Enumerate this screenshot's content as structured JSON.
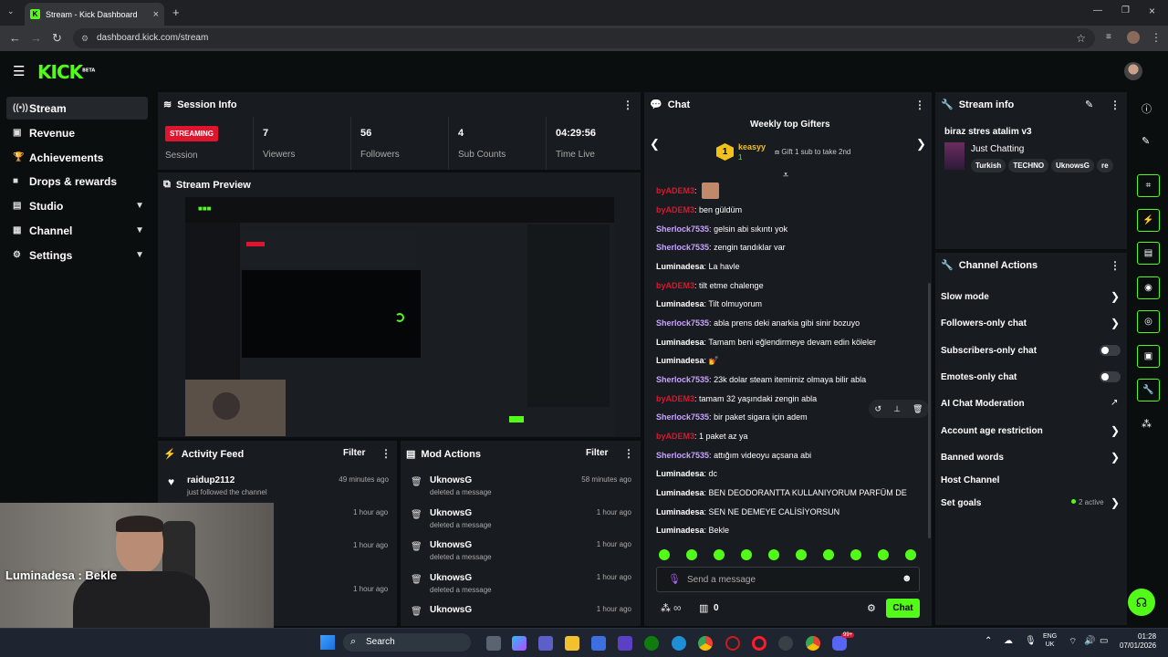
{
  "browser": {
    "tab_title": "Stream - Kick Dashboard",
    "url": "dashboard.kick.com/stream"
  },
  "header": {
    "logo": "KICK",
    "logo_tag": "BETA"
  },
  "sidebar": {
    "items": [
      {
        "label": "Stream",
        "icon": "broadcast-icon"
      },
      {
        "label": "Revenue",
        "icon": "revenue-icon"
      },
      {
        "label": "Achievements",
        "icon": "trophy-icon"
      },
      {
        "label": "Drops & rewards",
        "icon": "gift-icon"
      },
      {
        "label": "Studio",
        "icon": "studio-icon"
      },
      {
        "label": "Channel",
        "icon": "channel-icon"
      },
      {
        "label": "Settings",
        "icon": "gear-icon"
      }
    ]
  },
  "session": {
    "title": "Session Info",
    "status": "STREAMING",
    "status_label": "Session",
    "stats": [
      {
        "value": "7",
        "label": "Viewers"
      },
      {
        "value": "56",
        "label": "Followers"
      },
      {
        "value": "4",
        "label": "Sub Counts"
      },
      {
        "value": "04:29:56",
        "label": "Time Live"
      }
    ]
  },
  "preview": {
    "title": "Stream Preview"
  },
  "activity": {
    "title": "Activity Feed",
    "filter": "Filter",
    "items": [
      {
        "name": "raidup2112",
        "sub": "just followed the channel",
        "time": "49 minutes ago"
      },
      {
        "name": "",
        "sub": "",
        "time": "1 hour ago"
      },
      {
        "name": "",
        "sub": "",
        "time": "1 hour ago"
      },
      {
        "name": "",
        "sub": "",
        "time": "1 hour ago"
      }
    ]
  },
  "overlay": {
    "text": "Luminadesa : Bekle"
  },
  "mod": {
    "title": "Mod Actions",
    "filter": "Filter",
    "items": [
      {
        "name": "UknowsG",
        "sub": "deleted a message",
        "time": "58 minutes ago"
      },
      {
        "name": "UknowsG",
        "sub": "deleted a message",
        "time": "1 hour ago"
      },
      {
        "name": "UknowsG",
        "sub": "deleted a message",
        "time": "1 hour ago"
      },
      {
        "name": "UknowsG",
        "sub": "deleted a message",
        "time": "1 hour ago"
      },
      {
        "name": "UknowsG",
        "sub": "",
        "time": "1 hour ago"
      }
    ]
  },
  "chat": {
    "title": "Chat",
    "gifters_title": "Weekly top Gifters",
    "gifter_rank": "1",
    "gifter_name": "keasyy",
    "gifter_count": "1",
    "gift_hint": "Gift 1 sub to take 2nd",
    "messages": [
      {
        "user": "byADEM3",
        "text": "",
        "color": "#e1142d"
      },
      {
        "user": "byADEM3",
        "text": "ben güldüm",
        "color": "#e1142d"
      },
      {
        "user": "Sherlock7535",
        "text": "gelsin abi sıkıntı yok",
        "color": "#c9a4ff"
      },
      {
        "user": "Sherlock7535",
        "text": "zengin tandıklar var",
        "color": "#c9a4ff"
      },
      {
        "user": "Luminadesa",
        "text": "La havle",
        "color": "#ffffff"
      },
      {
        "user": "byADEM3",
        "text": "tilt etme chalenge",
        "color": "#e1142d"
      },
      {
        "user": "Luminadesa",
        "text": "Tilt olmuyorum",
        "color": "#ffffff"
      },
      {
        "user": "Sherlock7535",
        "text": "abla prens deki anarkia gibi sinir bozuyo",
        "color": "#c9a4ff"
      },
      {
        "user": "Luminadesa",
        "text": "Tamam beni eğlendirmeye devam edin köleler",
        "color": "#ffffff"
      },
      {
        "user": "Luminadesa",
        "text": "💅",
        "color": "#ffffff"
      },
      {
        "user": "Sherlock7535",
        "text": "23k dolar steam itemimiz olmaya bilir abla",
        "color": "#c9a4ff"
      },
      {
        "user": "byADEM3",
        "text": "tamam 32 yaşındaki zengin abla",
        "color": "#e1142d"
      },
      {
        "user": "Sherlock7535",
        "text": "bir paket sigara için adem",
        "color": "#c9a4ff"
      },
      {
        "user": "byADEM3",
        "text": "1 paket az ya",
        "color": "#e1142d"
      },
      {
        "user": "Sherlock7535",
        "text": "attığım videoyu açsana abi",
        "color": "#c9a4ff"
      },
      {
        "user": "Luminadesa",
        "text": "dc",
        "color": "#ffffff"
      },
      {
        "user": "Luminadesa",
        "text": "BEN DEODORANTTA KULLANIYORUM PARFÜM DE",
        "color": "#ffffff"
      },
      {
        "user": "Luminadesa",
        "text": "SEN NE DEMEYE CALİSİYORSUN",
        "color": "#ffffff"
      },
      {
        "user": "Luminadesa",
        "text": "Bekle",
        "color": "#ffffff"
      }
    ],
    "placeholder": "Send a message",
    "infinity": "∞",
    "count": "0",
    "send": "Chat"
  },
  "stream_info": {
    "title": "Stream info",
    "stream_title": "biraz stres atalim v3",
    "category": "Just Chatting",
    "tags": [
      "Turkish",
      "TECHNO",
      "UknowsG",
      "re"
    ]
  },
  "channel_actions": {
    "title": "Channel Actions",
    "items": [
      {
        "label": "Slow mode",
        "control": "arrow"
      },
      {
        "label": "Followers-only chat",
        "control": "arrow"
      },
      {
        "label": "Subscribers-only chat",
        "control": "toggle"
      },
      {
        "label": "Emotes-only chat",
        "control": "toggle"
      },
      {
        "label": "AI Chat Moderation",
        "control": "external"
      },
      {
        "label": "Account age restriction",
        "control": "arrow"
      },
      {
        "label": "Banned words",
        "control": "arrow"
      },
      {
        "label": "Host Channel",
        "control": "none"
      },
      {
        "label": "Set goals",
        "control": "arrow"
      }
    ],
    "goals_status": "2 active"
  },
  "taskbar": {
    "search": "Search",
    "lang": "ENG",
    "region": "UK",
    "time": "01:28",
    "date": "07/01/2026",
    "discord_badge": "99+"
  },
  "colors": {
    "accent": "#53fc18",
    "live": "#e1142d",
    "panel": "#181b1f",
    "bg": "#0b0e0f"
  }
}
